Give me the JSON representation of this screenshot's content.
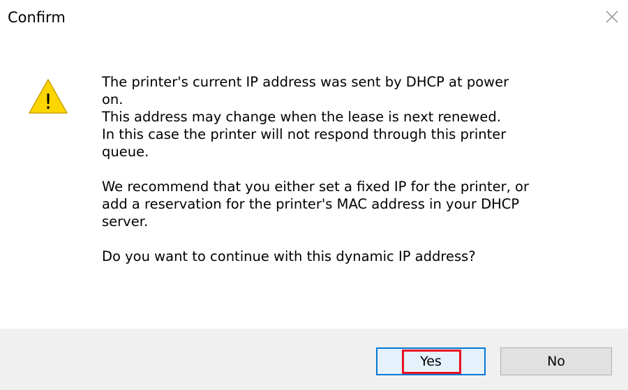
{
  "window": {
    "title": "Confirm",
    "close_icon": "close-icon"
  },
  "icon": {
    "name": "warning-icon",
    "glyph": "!",
    "fill_color": "#ffd500",
    "stroke_color": "#c8a200"
  },
  "message": {
    "paragraph1": "The printer's current IP address was sent by DHCP at power\non.\nThis address may change when the lease is next renewed.\nIn this case the printer will not respond through this printer\nqueue.",
    "paragraph2": "We recommend that you either set a fixed IP for the printer, or\nadd a reservation for the printer's MAC address in your DHCP\nserver.",
    "paragraph3": "Do you want to continue with this dynamic IP address?"
  },
  "buttons": {
    "yes_label": "Yes",
    "no_label": "No"
  },
  "colors": {
    "footer_background": "#f0f0f0",
    "default_button_border": "#0078d7",
    "default_button_background": "#e5f1fb",
    "highlight": "#e81123"
  }
}
